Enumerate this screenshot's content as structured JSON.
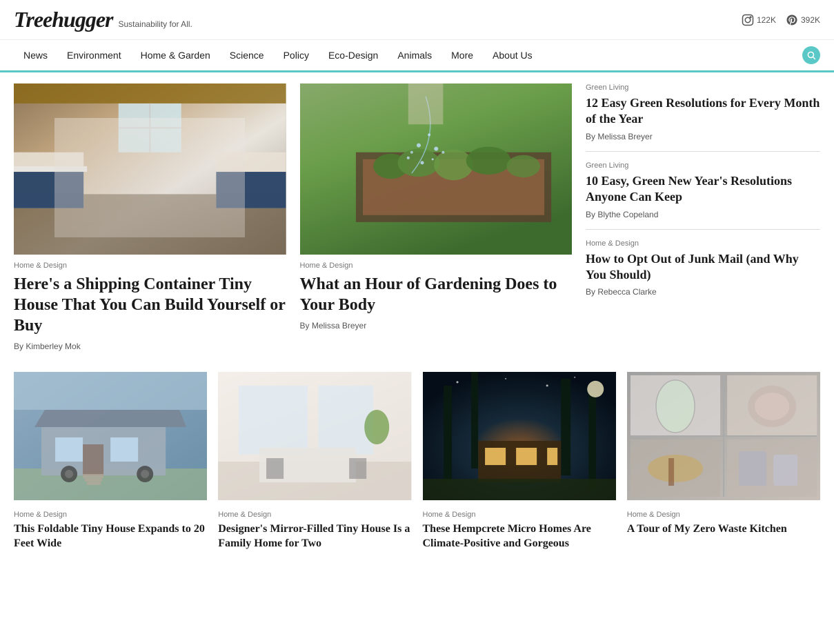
{
  "header": {
    "logo": "Treehugger",
    "tagline": "Sustainability for All.",
    "instagram": {
      "icon": "instagram-icon",
      "count": "122K"
    },
    "pinterest": {
      "icon": "pinterest-icon",
      "count": "392K"
    }
  },
  "nav": {
    "items": [
      {
        "label": "News",
        "href": "#"
      },
      {
        "label": "Environment",
        "href": "#"
      },
      {
        "label": "Home & Garden",
        "href": "#"
      },
      {
        "label": "Science",
        "href": "#"
      },
      {
        "label": "Policy",
        "href": "#"
      },
      {
        "label": "Eco-Design",
        "href": "#"
      },
      {
        "label": "Animals",
        "href": "#"
      },
      {
        "label": "More",
        "href": "#"
      },
      {
        "label": "About Us",
        "href": "#"
      }
    ]
  },
  "main": {
    "featured_left": {
      "category": "Home & Design",
      "title": "Here's a Shipping Container Tiny House That You Can Build Yourself or Buy",
      "author": "By Kimberley Mok"
    },
    "featured_center": {
      "category": "Home & Design",
      "title": "What an Hour of Gardening Does to Your Body",
      "author": "By Melissa Breyer"
    },
    "sidebar": [
      {
        "category": "Green Living",
        "title": "12 Easy Green Resolutions for Every Month of the Year",
        "author": "By Melissa Breyer"
      },
      {
        "category": "Green Living",
        "title": "10 Easy, Green New Year's Resolutions Anyone Can Keep",
        "author": "By Blythe Copeland"
      },
      {
        "category": "Home & Design",
        "title": "How to Opt Out of Junk Mail (and Why You Should)",
        "author": "By Rebecca Clarke"
      }
    ],
    "bottom_cards": [
      {
        "category": "Home & Design",
        "title": "This Foldable Tiny House Expands to 20 Feet Wide",
        "img_class": "img-tiny1"
      },
      {
        "category": "Home & Design",
        "title": "Designer's Mirror-Filled Tiny House Is a Family Home for Two",
        "img_class": "img-tiny2"
      },
      {
        "category": "Home & Design",
        "title": "These Hempcrete Micro Homes Are Climate-Positive and Gorgeous",
        "img_class": "img-night"
      },
      {
        "category": "Home & Design",
        "title": "A Tour of My Zero Waste Kitchen",
        "img_class": "img-waste"
      }
    ]
  },
  "colors": {
    "accent": "#5bc8c8",
    "text_dark": "#1a1a1a",
    "text_muted": "#777",
    "border": "#ddd"
  }
}
